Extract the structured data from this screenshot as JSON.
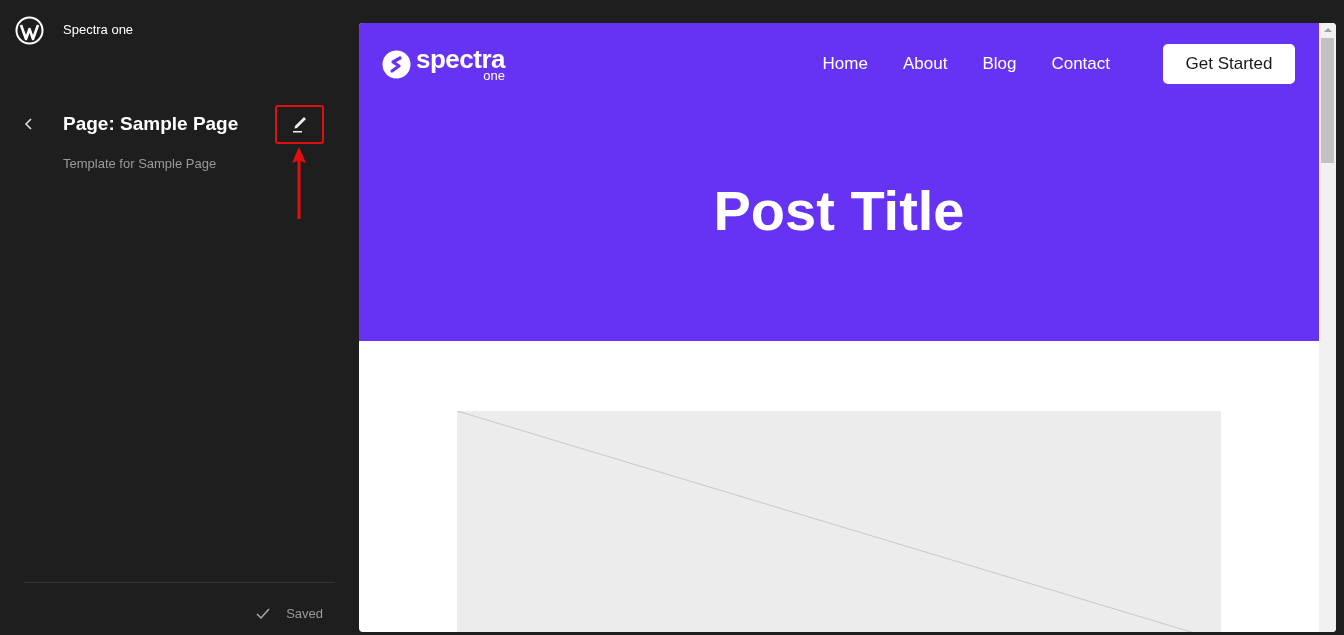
{
  "site": {
    "title": "Spectra one"
  },
  "panel": {
    "title": "Page: Sample Page",
    "description": "Template for Sample Page",
    "edit_highlighted": true
  },
  "status": {
    "label": "Saved"
  },
  "preview": {
    "logo": {
      "word": "spectra",
      "sub": "one"
    },
    "nav": [
      "Home",
      "About",
      "Blog",
      "Contact"
    ],
    "cta": "Get Started",
    "post_title": "Post Title",
    "featured_image": {
      "kind": "placeholder"
    }
  }
}
